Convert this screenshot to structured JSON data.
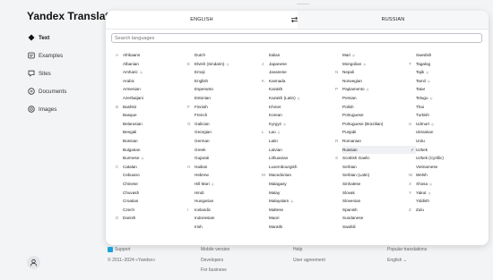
{
  "app": {
    "title": "Yandex Translate"
  },
  "sidebar": {
    "items": [
      {
        "label": "Text",
        "icon": "text-icon",
        "active": true
      },
      {
        "label": "Examples",
        "icon": "examples-icon",
        "active": false
      },
      {
        "label": "Sites",
        "icon": "sites-icon",
        "active": false
      },
      {
        "label": "Documents",
        "icon": "documents-icon",
        "active": false
      },
      {
        "label": "Images",
        "icon": "images-icon",
        "active": false
      }
    ]
  },
  "language_header": {
    "source": "ENGLISH",
    "target": "RUSSIAN",
    "swap_icon": "swap-icon"
  },
  "search": {
    "placeholder": "Search languages",
    "value": ""
  },
  "languages": {
    "columns": [
      [
        {
          "letter": "A",
          "name": "Afrikaans"
        },
        {
          "letter": "",
          "name": "Albanian"
        },
        {
          "letter": "",
          "name": "Amharic",
          "voice": true
        },
        {
          "letter": "",
          "name": "Arabic"
        },
        {
          "letter": "",
          "name": "Armenian"
        },
        {
          "letter": "",
          "name": "Azerbaijani"
        },
        {
          "letter": "B",
          "name": "Bashkir"
        },
        {
          "letter": "",
          "name": "Basque"
        },
        {
          "letter": "",
          "name": "Belarusian"
        },
        {
          "letter": "",
          "name": "Bengali"
        },
        {
          "letter": "",
          "name": "Bosnian"
        },
        {
          "letter": "",
          "name": "Bulgarian"
        },
        {
          "letter": "",
          "name": "Burmese",
          "voice": true
        },
        {
          "letter": "C",
          "name": "Catalan"
        },
        {
          "letter": "",
          "name": "Cebuano"
        },
        {
          "letter": "",
          "name": "Chinese"
        },
        {
          "letter": "",
          "name": "Chuvash"
        },
        {
          "letter": "",
          "name": "Croatian"
        },
        {
          "letter": "",
          "name": "Czech"
        },
        {
          "letter": "D",
          "name": "Danish"
        }
      ],
      [
        {
          "letter": "",
          "name": "Dutch"
        },
        {
          "letter": "E",
          "name": "Elvish (Sindarin)",
          "voice": true
        },
        {
          "letter": "",
          "name": "Emoji"
        },
        {
          "letter": "",
          "name": "English"
        },
        {
          "letter": "",
          "name": "Esperanto"
        },
        {
          "letter": "",
          "name": "Estonian"
        },
        {
          "letter": "F",
          "name": "Finnish"
        },
        {
          "letter": "",
          "name": "French"
        },
        {
          "letter": "G",
          "name": "Galician"
        },
        {
          "letter": "",
          "name": "Georgian"
        },
        {
          "letter": "",
          "name": "German"
        },
        {
          "letter": "",
          "name": "Greek"
        },
        {
          "letter": "",
          "name": "Gujarati"
        },
        {
          "letter": "H",
          "name": "Haitian"
        },
        {
          "letter": "",
          "name": "Hebrew"
        },
        {
          "letter": "",
          "name": "Hill Mari",
          "voice": true
        },
        {
          "letter": "",
          "name": "Hindi"
        },
        {
          "letter": "",
          "name": "Hungarian"
        },
        {
          "letter": "I",
          "name": "Icelandic"
        },
        {
          "letter": "",
          "name": "Indonesian"
        },
        {
          "letter": "",
          "name": "Irish"
        }
      ],
      [
        {
          "letter": "",
          "name": "Italian"
        },
        {
          "letter": "J",
          "name": "Japanese"
        },
        {
          "letter": "",
          "name": "Javanese"
        },
        {
          "letter": "K",
          "name": "Kannada"
        },
        {
          "letter": "",
          "name": "Kazakh"
        },
        {
          "letter": "",
          "name": "Kazakh (Latin)",
          "voice": true
        },
        {
          "letter": "",
          "name": "Khmer"
        },
        {
          "letter": "",
          "name": "Korean"
        },
        {
          "letter": "",
          "name": "Kyrgyz",
          "voice": true
        },
        {
          "letter": "L",
          "name": "Lao",
          "voice": true
        },
        {
          "letter": "",
          "name": "Latin"
        },
        {
          "letter": "",
          "name": "Latvian"
        },
        {
          "letter": "",
          "name": "Lithuanian"
        },
        {
          "letter": "",
          "name": "Luxembourgish"
        },
        {
          "letter": "M",
          "name": "Macedonian"
        },
        {
          "letter": "",
          "name": "Malagasy"
        },
        {
          "letter": "",
          "name": "Malay"
        },
        {
          "letter": "",
          "name": "Malayalam",
          "voice": true
        },
        {
          "letter": "",
          "name": "Maltese"
        },
        {
          "letter": "",
          "name": "Maori"
        },
        {
          "letter": "",
          "name": "Marathi"
        }
      ],
      [
        {
          "letter": "",
          "name": "Mari",
          "voice": true
        },
        {
          "letter": "",
          "name": "Mongolian",
          "voice": true
        },
        {
          "letter": "N",
          "name": "Nepali"
        },
        {
          "letter": "",
          "name": "Norwegian"
        },
        {
          "letter": "P",
          "name": "Papiamento",
          "voice": true
        },
        {
          "letter": "",
          "name": "Persian"
        },
        {
          "letter": "",
          "name": "Polish"
        },
        {
          "letter": "",
          "name": "Portuguese"
        },
        {
          "letter": "",
          "name": "Portuguese (Brazilian)"
        },
        {
          "letter": "",
          "name": "Punjabi"
        },
        {
          "letter": "R",
          "name": "Romanian"
        },
        {
          "letter": "",
          "name": "Russian",
          "selected": true
        },
        {
          "letter": "S",
          "name": "Scottish Gaelic"
        },
        {
          "letter": "",
          "name": "Serbian"
        },
        {
          "letter": "",
          "name": "Serbian (Latin)"
        },
        {
          "letter": "",
          "name": "Sinhalese"
        },
        {
          "letter": "",
          "name": "Slovak"
        },
        {
          "letter": "",
          "name": "Slovenian"
        },
        {
          "letter": "",
          "name": "Spanish"
        },
        {
          "letter": "",
          "name": "Sundanese"
        },
        {
          "letter": "",
          "name": "Swahili"
        }
      ],
      [
        {
          "letter": "",
          "name": "Swedish"
        },
        {
          "letter": "T",
          "name": "Tagalog"
        },
        {
          "letter": "",
          "name": "Tajik",
          "voice": true
        },
        {
          "letter": "",
          "name": "Tamil",
          "voice": true
        },
        {
          "letter": "",
          "name": "Tatar"
        },
        {
          "letter": "",
          "name": "Telugu",
          "voice": true
        },
        {
          "letter": "",
          "name": "Thai"
        },
        {
          "letter": "",
          "name": "Turkish"
        },
        {
          "letter": "U",
          "name": "Udmurt",
          "voice": true
        },
        {
          "letter": "",
          "name": "Ukrainian"
        },
        {
          "letter": "",
          "name": "Urdu"
        },
        {
          "letter": "",
          "name": "Uzbek"
        },
        {
          "letter": "",
          "name": "Uzbek (Cyrillic)"
        },
        {
          "letter": "",
          "name": "Vietnamese"
        },
        {
          "letter": "W",
          "name": "Welsh"
        },
        {
          "letter": "X",
          "name": "Xhosa",
          "voice": true
        },
        {
          "letter": "Y",
          "name": "Yakut",
          "voice": true
        },
        {
          "letter": "",
          "name": "Yiddish"
        },
        {
          "letter": "Z",
          "name": "Zulu"
        }
      ]
    ]
  },
  "footer": {
    "support": "Support",
    "copyright": "© 2011–2024 «Yandex»",
    "mobile_version": "Mobile version",
    "developers": "Developers",
    "for_business": "For business",
    "help": "Help",
    "user_agreement": "User agreement",
    "popular_translations": "Popular translations",
    "language": "English"
  },
  "colors": {
    "background": "#f3f4f6",
    "panel": "#ffffff",
    "selected_row": "#eef0f3"
  }
}
